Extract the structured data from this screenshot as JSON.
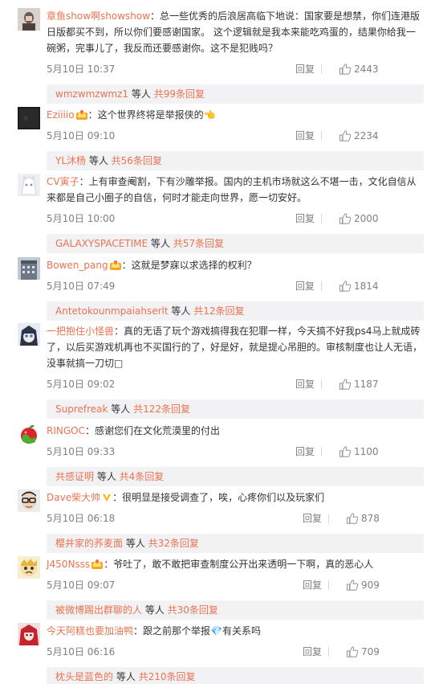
{
  "comments": [
    {
      "user": "章鱼show啊showshow",
      "badge": "",
      "text": "：总一些优秀的后浪居高临下地说：国家要是想禁，你们连港版日版都买不到，所以你们要感谢国家。 这个逻辑就是我本来能吃鸡蛋的，结果你给我一碗粥，完事儿了，我反而还要感谢你。这不是犯贱吗？",
      "time": "5月10日 10:37",
      "reply_label": "回复",
      "likes": "2443",
      "sub_user": "wmzwmzwmz1",
      "sub_mid": " 等人 ",
      "sub_count": "共99条回复",
      "avatar": "avatar-portrait"
    },
    {
      "user": "Eziiiio",
      "badge": "crown",
      "text": "：这个世界终将是举报侠的👈",
      "time": "5月10日 09:10",
      "reply_label": "回复",
      "likes": "2234",
      "sub_user": "YL沐杨",
      "sub_mid": " 等人 ",
      "sub_count": "共56条回复",
      "avatar": "avatar-dark"
    },
    {
      "user": "CV寅子",
      "badge": "",
      "text": "：上有审查阉割，下有沙雕举报。国内的主机市场就这么不堪一击，文化自信从来都是自己小圈子的自信，何时才能走向世界，愿一切安好。",
      "time": "5月10日 10:00",
      "reply_label": "回复",
      "likes": "2000",
      "sub_user": "GALAXYSPACETIME",
      "sub_mid": " 等人 ",
      "sub_count": "共57条回复",
      "avatar": "avatar-anime-white"
    },
    {
      "user": "Bowen_pang",
      "badge": "crown",
      "text": "：这就是梦寐以求选择的权利？",
      "time": "5月10日 07:49",
      "reply_label": "回复",
      "likes": "1814",
      "sub_user": "Antetokounmpaiahserlt",
      "sub_mid": " 等人 ",
      "sub_count": "共12条回复",
      "avatar": "avatar-building"
    },
    {
      "user": "一把抱住小怪兽",
      "badge": "",
      "text": "：真的无语了玩个游戏搞得我在犯罪一样，今天搞不好我ps4马上就成砖了，以后买游戏机再也不买国行的了，好是好，就是提心吊胆的。审核制度也让人无语，没事就搞一刀切□",
      "time": "5月10日 09:02",
      "reply_label": "回复",
      "likes": "1187",
      "sub_user": "Suprefreak",
      "sub_mid": " 等人 ",
      "sub_count": "共122条回复",
      "avatar": "avatar-anime-blue"
    },
    {
      "user": "RINGOC",
      "badge": "",
      "text": "：感谢您们在文化荒漠里的付出",
      "time": "5月10日 09:33",
      "reply_label": "回复",
      "likes": "1100",
      "sub_user": "共感证明",
      "sub_mid": " 等人 ",
      "sub_count": "共4条回复",
      "avatar": "avatar-apple"
    },
    {
      "user": "Dave柴大帅",
      "badge": "vip",
      "text": "：很明显是接受调查了，唉，心疼你们以及玩家们",
      "time": "5月10日 06:18",
      "reply_label": "回复",
      "likes": "878",
      "sub_user": "樱井家的荞麦面",
      "sub_mid": " 等人 ",
      "sub_count": "共32条回复",
      "avatar": "avatar-glasses"
    },
    {
      "user": "J450Nsss",
      "badge": "crown",
      "text": "：爷吐了，敢不敢把审查制度公开出来透明一下啊，真的恶心人",
      "time": "5月10日 09:07",
      "reply_label": "回复",
      "likes": "909",
      "sub_user": "被微博踢出群聊的人",
      "sub_mid": " 等人 ",
      "sub_count": "共30条回复",
      "avatar": "avatar-cartoon"
    },
    {
      "user": "今天阿糕也要加油鸭",
      "badge": "",
      "text": "：跟之前那个举报💎有关系吗",
      "time": "5月10日 06:16",
      "reply_label": "回复",
      "likes": "709",
      "sub_user": "枕头是蓝色的",
      "sub_mid": " 等人 ",
      "sub_count": "共210条回复",
      "avatar": "avatar-red-girl"
    }
  ],
  "colors": {
    "username": "#eb7350",
    "meta": "#808080",
    "reply_bg": "#f2f2f5"
  },
  "icons": {
    "like": "thumbs-up-icon",
    "crown_badge": "crown-badge-icon",
    "vip_badge": "vip-badge-icon"
  }
}
